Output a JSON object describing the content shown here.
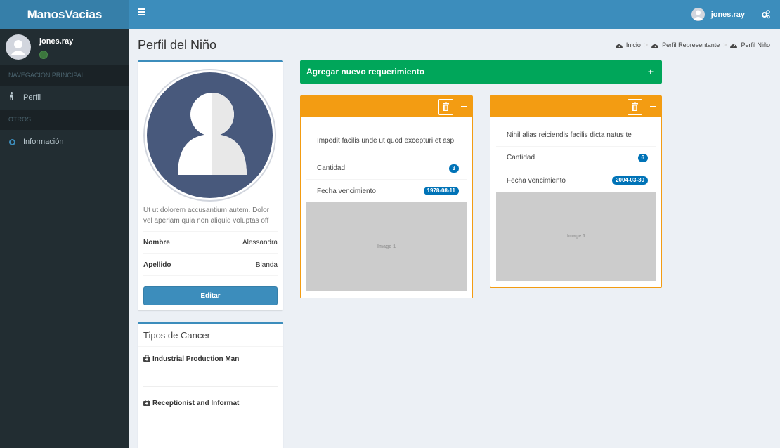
{
  "app": {
    "title": "ManosVacias"
  },
  "navbar": {
    "user_name": "jones.ray"
  },
  "sidebar": {
    "user_name": "jones.ray",
    "sections": [
      {
        "header": "NAVEGACION PRINCIPAL",
        "items": [
          {
            "label": "Perfil",
            "icon": "child-icon"
          }
        ]
      },
      {
        "header": "OTROS",
        "items": [
          {
            "label": "Información",
            "icon": "circle-icon"
          }
        ]
      }
    ]
  },
  "page": {
    "title": "Perfil del Niño",
    "breadcrumb": [
      "Inicio",
      "Perfil Representante",
      "Perfil Niño"
    ]
  },
  "profile": {
    "description": "Ut ut dolorem accusantium autem. Dolor vel aperiam quia non aliquid voluptas off",
    "fields": [
      {
        "label": "Nombre",
        "value": "Alessandra"
      },
      {
        "label": "Apellido",
        "value": "Blanda"
      }
    ],
    "edit_label": "Editar"
  },
  "cancer_types": {
    "title": "Tipos de Cancer",
    "items": [
      "Industrial Production Man",
      "Receptionist and Informat"
    ]
  },
  "add_requirement": {
    "label": "Agregar nuevo requerimiento"
  },
  "requirements": [
    {
      "description": "Impedit facilis unde ut quod excepturi et asp",
      "quantity_label": "Cantidad",
      "quantity": "3",
      "expiry_label": "Fecha vencimiento",
      "expiry": "1978-08-11",
      "image_label": "Image 1"
    },
    {
      "description": "Nihil alias reiciendis facilis dicta natus te",
      "quantity_label": "Cantidad",
      "quantity": "6",
      "expiry_label": "Fecha vencimiento",
      "expiry": "2004-03-30",
      "image_label": "Image 1"
    }
  ],
  "colors": {
    "primary": "#3c8dbc",
    "success": "#00a65a",
    "warning": "#f39c12",
    "sidebar": "#222d32",
    "badge": "#0073b7"
  }
}
